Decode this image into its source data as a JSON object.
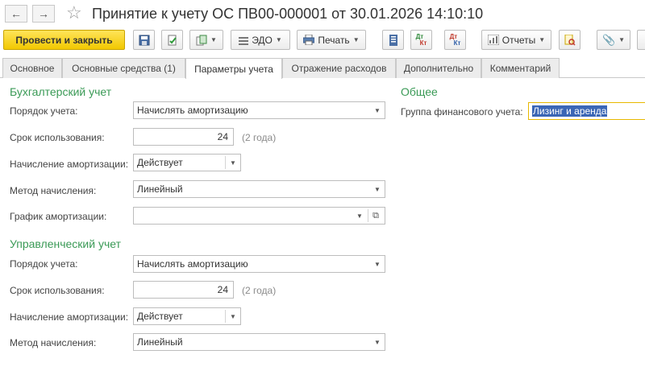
{
  "window": {
    "title": "Принятие к учету ОС ПВ00-000001 от 30.01.2026 14:10:10"
  },
  "toolbar": {
    "post_and_close": "Провести и закрыть",
    "edo": "ЭДО",
    "print": "Печать",
    "reports": "Отчеты",
    "dt_kt_top": "Дт",
    "dt_kt_bottom": "Кт"
  },
  "tabs": [
    {
      "label": "Основное"
    },
    {
      "label": "Основные средства (1)"
    },
    {
      "label": "Параметры учета"
    },
    {
      "label": "Отражение расходов"
    },
    {
      "label": "Дополнительно"
    },
    {
      "label": "Комментарий"
    }
  ],
  "accounting": {
    "title": "Бухгалтерский учет",
    "order_label": "Порядок учета:",
    "order_value": "Начислять амортизацию",
    "term_label": "Срок использования:",
    "term_value": "24",
    "term_hint": "(2 года)",
    "depreciation_label": "Начисление амортизации:",
    "depreciation_value": "Действует",
    "method_label": "Метод начисления:",
    "method_value": "Линейный",
    "schedule_label": "График амортизации:",
    "schedule_value": ""
  },
  "management": {
    "title": "Управленческий учет",
    "order_label": "Порядок учета:",
    "order_value": "Начислять амортизацию",
    "term_label": "Срок использования:",
    "term_value": "24",
    "term_hint": "(2 года)",
    "depreciation_label": "Начисление амортизации:",
    "depreciation_value": "Действует",
    "method_label": "Метод начисления:",
    "method_value": "Линейный"
  },
  "general": {
    "title": "Общее",
    "group_label": "Группа финансового учета:",
    "group_value": "Лизинг и аренда"
  },
  "colors": {
    "accent_yellow": "#f2c800",
    "section_green": "#3a9a56",
    "selection_blue": "#3b66b5"
  }
}
